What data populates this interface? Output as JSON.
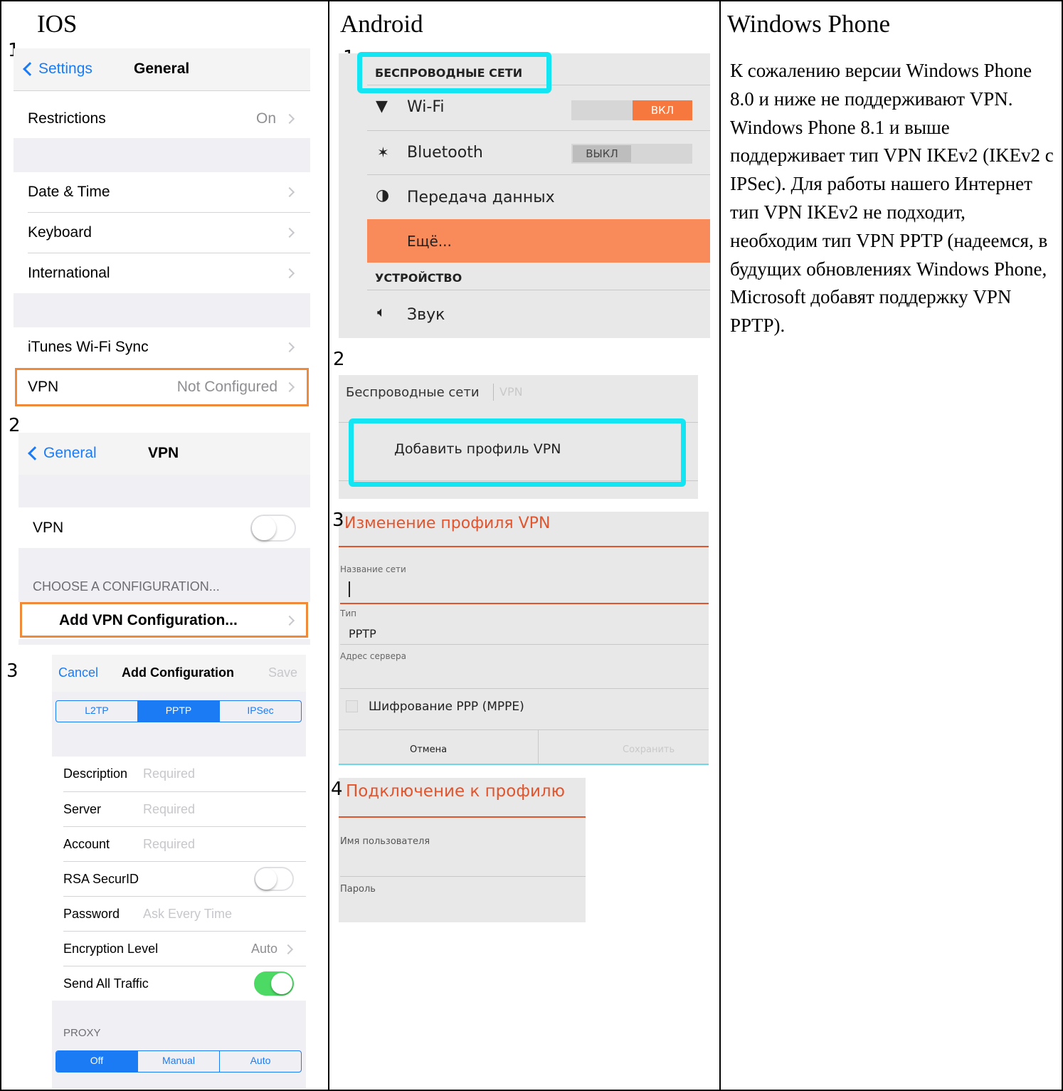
{
  "columns": {
    "ios": "IOS",
    "android": "Android",
    "windows": "Windows Phone"
  },
  "ios": {
    "s1": {
      "step": "1",
      "back": "Settings",
      "title": "General",
      "rows": {
        "restrictions": {
          "label": "Restrictions",
          "value": "On"
        },
        "date_time": {
          "label": "Date & Time"
        },
        "keyboard": {
          "label": "Keyboard"
        },
        "international": {
          "label": "International"
        },
        "itunes": {
          "label": "iTunes Wi-Fi Sync"
        },
        "vpn": {
          "label": "VPN",
          "value": "Not Configured"
        }
      }
    },
    "s2": {
      "step": "2",
      "back": "General",
      "title": "VPN",
      "vpn_label": "VPN",
      "section": "CHOOSE A CONFIGURATION...",
      "add": "Add VPN Configuration..."
    },
    "s3": {
      "step": "3",
      "cancel": "Cancel",
      "title": "Add Configuration",
      "save": "Save",
      "types": [
        "L2TP",
        "PPTP",
        "IPSec"
      ],
      "fields": {
        "description": {
          "label": "Description",
          "placeholder": "Required"
        },
        "server": {
          "label": "Server",
          "placeholder": "Required"
        },
        "account": {
          "label": "Account",
          "placeholder": "Required"
        },
        "rsa": {
          "label": "RSA SecurID"
        },
        "password": {
          "label": "Password",
          "placeholder": "Ask Every Time"
        },
        "encryption": {
          "label": "Encryption Level",
          "value": "Auto"
        },
        "send_all": {
          "label": "Send All Traffic"
        }
      },
      "proxy": "PROXY",
      "proxy_opts": [
        "Off",
        "Manual",
        "Auto"
      ]
    }
  },
  "android": {
    "s1": {
      "step": "1",
      "header": "БЕСПРОВОДНЫЕ СЕТИ",
      "wifi": "Wi-Fi",
      "wifi_state": "ВКЛ",
      "bt": "Bluetooth",
      "bt_state": "ВЫКЛ",
      "data": "Передача данных",
      "more": "Ещё...",
      "device": "УСТРОЙСТВО",
      "sound": "Звук"
    },
    "s2": {
      "step": "2",
      "crumb": "Беспроводные сети",
      "crumb2": "VPN",
      "add": "Добавить профиль VPN"
    },
    "s3": {
      "step": "3",
      "title": "Изменение профиля VPN",
      "name_label": "Название сети",
      "type_label": "Тип",
      "type_value": "PPTP",
      "server_label": "Адрес сервера",
      "mppe": "Шифрование PPP (MPPE)",
      "cancel": "Отмена",
      "save": "Сохранить"
    },
    "s4": {
      "step": "4",
      "title": "Подключение к профилю",
      "user_label": "Имя пользователя",
      "pass_label": "Пароль"
    }
  },
  "windows": {
    "text": "К сожалению версии Windows Phone 8.0 и ниже не поддерживают VPN. Windows Phone 8.1 и выше поддерживает тип VPN IKEv2 (IKEv2 с IPSec). Для работы нашего Интернет тип VPN IKEv2 не подходит, необходим тип VPN PPTP (надеемся, в будущих обновлениях Windows Phone, Microsoft добавят поддержку VPN PPTP)."
  },
  "colors": {
    "ios_blue": "#1a7bf5",
    "ios_orange_highlight": "#f08a3b",
    "android_cyan_highlight": "#13e6f2",
    "android_orange": "#f98a5a",
    "ios_green": "#4cd964"
  }
}
